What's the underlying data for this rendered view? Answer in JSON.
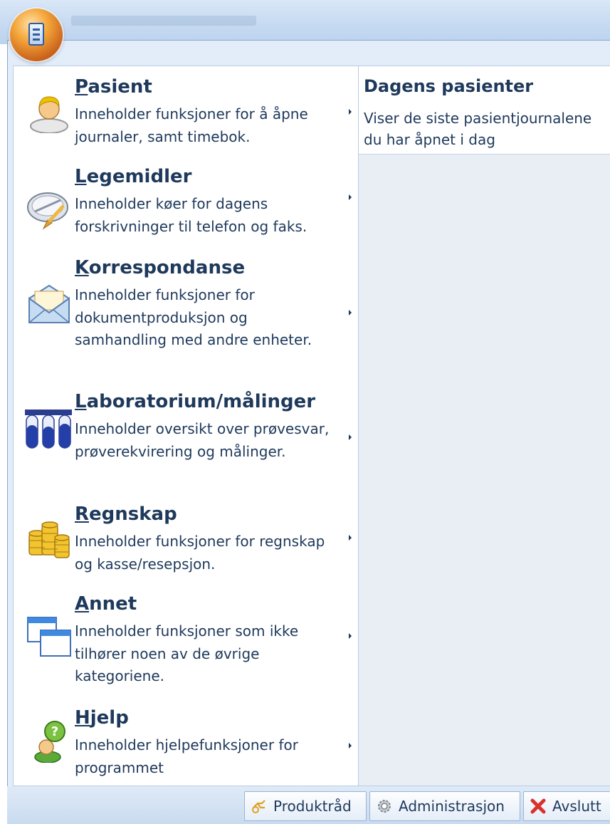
{
  "menu": {
    "items": [
      {
        "accel": "P",
        "rest": "asient",
        "description": "Inneholder funksjoner for å åpne journaler, samt timebok.",
        "icon": "patient-icon"
      },
      {
        "accel": "L",
        "rest": "egemidler",
        "description": "Inneholder køer for dagens forskrivninger til telefon og faks.",
        "icon": "pill-icon"
      },
      {
        "accel": "K",
        "rest": "orrespondanse",
        "description": "Inneholder funksjoner for dokumentproduksjon og samhandling med andre enheter.",
        "icon": "envelope-icon"
      },
      {
        "accel": "L",
        "rest": "aboratorium/målinger",
        "description": "Inneholder oversikt over prøvesvar, prøverekvirering og målinger.",
        "icon": "test-tubes-icon"
      },
      {
        "accel": "R",
        "rest": "egnskap",
        "description": "Inneholder funksjoner for regnskap og kasse/resepsjon.",
        "icon": "coins-icon"
      },
      {
        "accel": "A",
        "rest": "nnet",
        "description": "Inneholder funksjoner som ikke tilhører noen av de øvrige kategoriene.",
        "icon": "windows-icon"
      },
      {
        "accel": "H",
        "rest": "jelp",
        "description": "Inneholder hjelpefunksjoner for programmet",
        "icon": "help-icon"
      }
    ]
  },
  "recent": {
    "title": "Dagens pasienter",
    "description": "Viser de siste pasientjournalene du har åpnet i dag"
  },
  "footer": {
    "buttons": [
      {
        "label": "Produktråd",
        "icon": "idea-icon"
      },
      {
        "label": "Administrasjon",
        "icon": "gear-icon"
      },
      {
        "label": "Avslutt",
        "icon": "close-icon"
      }
    ]
  }
}
